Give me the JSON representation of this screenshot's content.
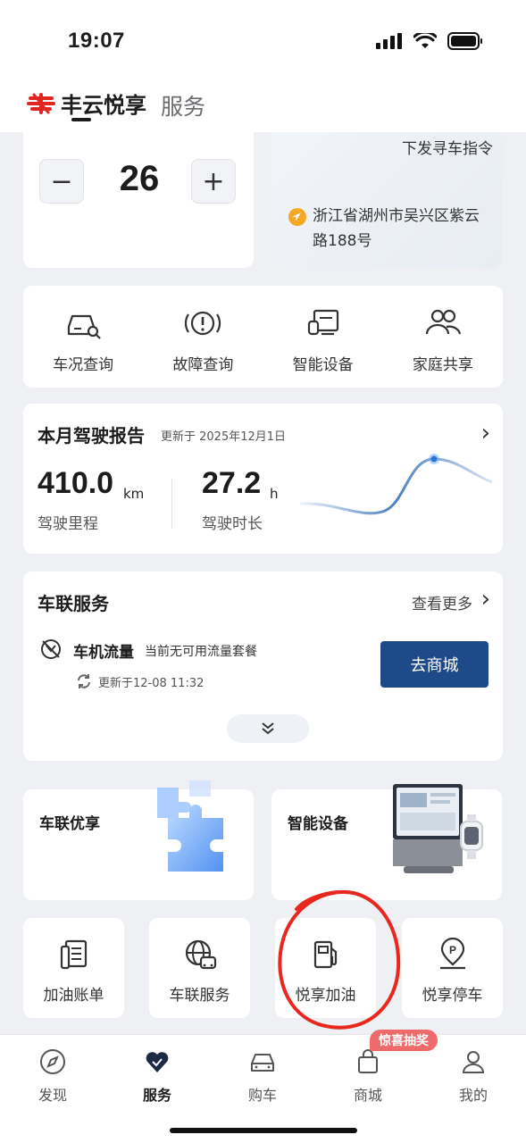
{
  "status_bar": {
    "time": "19:07"
  },
  "header": {
    "brand": "丰云悦享",
    "tab": "服务"
  },
  "control": {
    "value": "26",
    "minus": "−",
    "plus": "+"
  },
  "map": {
    "command": "下发寻车指令",
    "location": "浙江省湖州市吴兴区紫云路188号"
  },
  "quick_actions": [
    {
      "label": "车况查询",
      "icon": "car-search-icon"
    },
    {
      "label": "故障查询",
      "icon": "warning-icon"
    },
    {
      "label": "智能设备",
      "icon": "smart-device-icon"
    },
    {
      "label": "家庭共享",
      "icon": "family-icon"
    }
  ],
  "report": {
    "title": "本月驾驶报告",
    "updated": "更新于 2025年12月1日",
    "distance": "410.0",
    "distance_unit": "km",
    "distance_label": "驾驶里程",
    "duration": "27.2",
    "duration_unit": "h",
    "duration_label": "驾驶时长"
  },
  "telematics": {
    "title": "车联服务",
    "more": "查看更多",
    "item_name": "车机流量",
    "item_status": "当前无可用流量套餐",
    "item_updated": "更新于12-08 11:32",
    "shop_button": "去商城"
  },
  "promos": [
    {
      "title": "车联优享"
    },
    {
      "title": "智能设备"
    }
  ],
  "services": [
    {
      "label": "加油账单",
      "icon": "receipt-icon"
    },
    {
      "label": "车联服务",
      "icon": "connected-car-icon"
    },
    {
      "label": "悦享加油",
      "icon": "fuel-pump-icon"
    },
    {
      "label": "悦享停车",
      "icon": "parking-icon"
    }
  ],
  "bottom_nav": {
    "items": [
      {
        "label": "发现",
        "icon": "compass-icon"
      },
      {
        "label": "服务",
        "icon": "heart-icon",
        "active": true
      },
      {
        "label": "购车",
        "icon": "car-icon"
      },
      {
        "label": "商城",
        "icon": "bag-icon"
      },
      {
        "label": "我的",
        "icon": "person-icon"
      }
    ],
    "badge": "惊喜抽奖"
  },
  "colors": {
    "primary": "#1f4a8a",
    "accent_red": "#e2261f",
    "background": "#eef0f4"
  }
}
